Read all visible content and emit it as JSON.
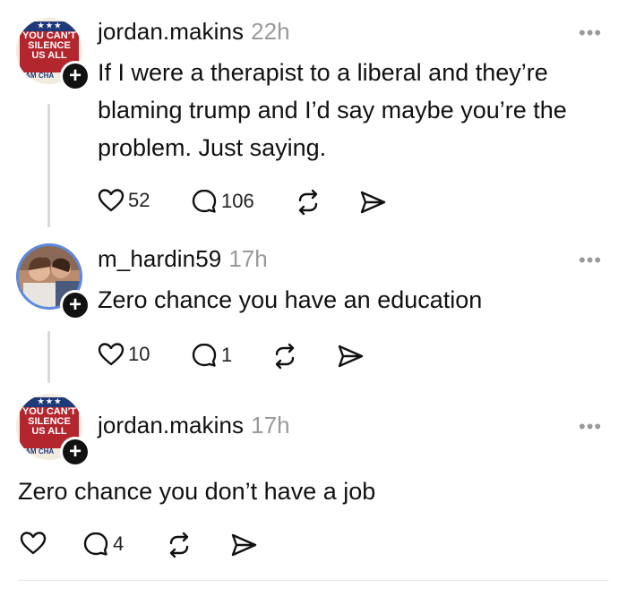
{
  "posts": [
    {
      "avatar_lines": [
        "★ ★ ★",
        "YOU CAN'T",
        "SILENCE",
        "US ALL",
        "I AM CHA"
      ],
      "username": "jordan.makins",
      "time": "22h",
      "text_lines": [
        "If I were a therapist to a liberal and they’re",
        "blaming trump and I’d say maybe you’re the",
        "problem. Just saying."
      ],
      "likes": "52",
      "replies": "106"
    },
    {
      "username": "m_hardin59",
      "time": "17h",
      "text_lines": [
        "Zero chance you have an education"
      ],
      "likes": "10",
      "replies": "1"
    },
    {
      "avatar_lines": [
        "★ ★ ★",
        "YOU CAN'T",
        "SILENCE",
        "US ALL",
        "I AM CHA"
      ],
      "username": "jordan.makins",
      "time": "17h",
      "text_lines": [
        "Zero chance you don’t have a job"
      ],
      "likes": "",
      "replies": "4"
    }
  ],
  "more_label": "•••",
  "plus_label": "+"
}
